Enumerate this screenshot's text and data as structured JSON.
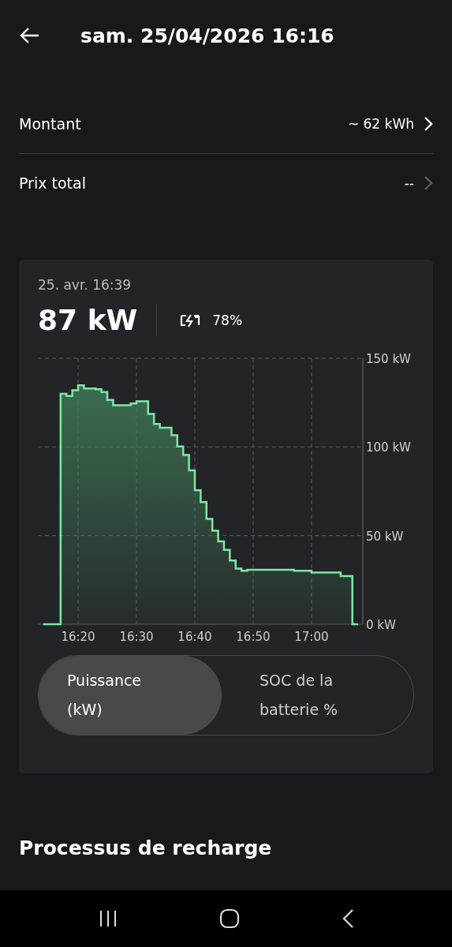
{
  "header": {
    "title": "sam. 25/04/2026 16:16"
  },
  "rows": [
    {
      "label": "Montant",
      "value": "~ 62 kWh",
      "disabled": false
    },
    {
      "label": "Prix total",
      "value": "--",
      "disabled": true
    }
  ],
  "card": {
    "timestamp": "25. avr. 16:39",
    "power": "87 kW",
    "battery": "78%",
    "chart_data": {
      "type": "area",
      "grid": true,
      "ylim": [
        0,
        150
      ],
      "yticks": [
        {
          "value": 0,
          "label": "0 kW"
        },
        {
          "value": 50,
          "label": "50 kW"
        },
        {
          "value": 100,
          "label": "100 kW"
        },
        {
          "value": 150,
          "label": "150 kW"
        }
      ],
      "categories": [
        null,
        null,
        null,
        null,
        null,
        null,
        "16:20",
        null,
        null,
        null,
        null,
        null,
        null,
        null,
        null,
        null,
        "16:30",
        null,
        null,
        null,
        null,
        null,
        null,
        null,
        null,
        null,
        "16:40",
        null,
        null,
        null,
        null,
        null,
        null,
        null,
        null,
        null,
        "16:50",
        null,
        null,
        null,
        null,
        null,
        null,
        null,
        null,
        null,
        "17:00",
        null,
        null,
        null,
        null,
        null,
        null,
        null,
        null
      ],
      "series": [
        {
          "color": "#7ee8a4",
          "values": [
            0,
            0,
            0,
            130,
            128.7,
            132,
            134.7,
            133,
            133,
            132.5,
            131,
            126.5,
            123.5,
            123.5,
            123.5,
            124.5,
            125.7,
            125.7,
            118.6,
            113,
            110.8,
            110.8,
            106.6,
            100.3,
            95.5,
            86.8,
            75.6,
            68.9,
            59.4,
            52.7,
            46.7,
            41.9,
            35.9,
            31.4,
            30.2,
            30.7,
            30.7,
            30.7,
            30.7,
            30.7,
            30.7,
            30.7,
            30.7,
            30.2,
            30.2,
            30.2,
            29.2,
            29.2,
            29.2,
            29.2,
            29.2,
            27.2,
            27.2,
            0,
            0
          ]
        }
      ]
    },
    "toggle": [
      {
        "label": "Puissance (kW)",
        "selected": true
      },
      {
        "label": "SOC de la batterie %",
        "selected": false
      }
    ]
  },
  "section": {
    "title": "Processus de recharge"
  }
}
